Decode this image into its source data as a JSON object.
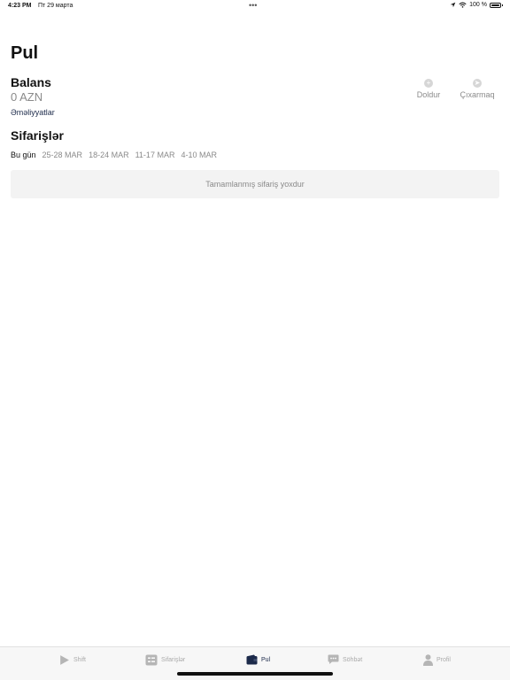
{
  "status_bar": {
    "time": "4:23 PM",
    "date": "Пт 29 марта",
    "dots": "•••",
    "battery": "100 %",
    "battery_level": 1.0
  },
  "page": {
    "title": "Pul"
  },
  "balance": {
    "label": "Balans",
    "amount": "0 AZN",
    "transactions_link": "Əməliyyatlar"
  },
  "actions": {
    "topup_label": "Doldur",
    "withdraw_label": "Çıxarmaq"
  },
  "orders": {
    "title": "Sifarişlər",
    "tabs": [
      "Bu gün",
      "25-28 MAR",
      "18-24 MAR",
      "11-17 MAR",
      "4-10 MAR"
    ],
    "active_tab": "Bu gün",
    "empty_message": "Tamamlanmış sifariş yoxdur"
  },
  "tab_bar": {
    "items": [
      {
        "label": "Shift",
        "icon": "play-icon"
      },
      {
        "label": "Sifarişlər",
        "icon": "list-icon"
      },
      {
        "label": "Pul",
        "icon": "wallet-icon"
      },
      {
        "label": "Söhbət",
        "icon": "chat-icon"
      },
      {
        "label": "Profil",
        "icon": "person-icon"
      }
    ],
    "active": "Pul"
  },
  "colors": {
    "accent": "#1c2a4a",
    "muted": "#8a8a8a",
    "box_bg": "#f3f3f3"
  }
}
